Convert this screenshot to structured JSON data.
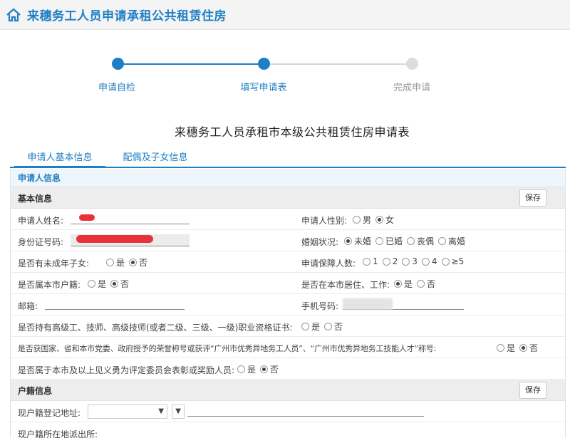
{
  "header": {
    "title": "来穗务工人员申请承租公共租赁住房"
  },
  "steps": [
    {
      "label": "申请自检"
    },
    {
      "label": "填写申请表"
    },
    {
      "label": "完成申请"
    }
  ],
  "form_title": "来穗务工人员承租市本级公共租赁住房申请表",
  "tabs": [
    {
      "label": "申请人基本信息"
    },
    {
      "label": "配偶及子女信息"
    }
  ],
  "panel_header": "申请人信息",
  "basic": {
    "title": "基本信息",
    "save_label": "保存",
    "name_label": "申请人姓名:",
    "gender_label": "申请人性别:",
    "gender_options": [
      "男",
      "女"
    ],
    "gender_selected": "女",
    "id_label": "身份证号码:",
    "marital_label": "婚姻状况:",
    "marital_options": [
      "未婚",
      "已婚",
      "丧偶",
      "离婚"
    ],
    "marital_selected": "未婚",
    "minor_label": "是否有未成年子女:",
    "yes": "是",
    "no": "否",
    "household_count_label": "申请保障人数:",
    "household_count_options": [
      "1",
      "2",
      "3",
      "4",
      "≥5"
    ],
    "local_hukou_label": "是否属本市户籍:",
    "live_work_label": "是否在本市居住、工作:",
    "email_label": "邮箱:",
    "phone_label": "手机号码:",
    "qualification_label": "是否持有高级工、技师、高级技师(或者二级、三级、一级)职业资格证书:",
    "honor_label": "是否获国家、省和本市党委、政府授予的荣誉称号或获评“广州市优秀异地务工人员”、“广州市优秀异地务工技能人才”称号:",
    "hero_label": "是否属于本市及以上见义勇为评定委员会表彰或奖励人员:"
  },
  "hukou": {
    "title": "户籍信息",
    "save_label": "保存",
    "address_label": "现户籍登记地址:",
    "police_label": "现户籍所在地派出所:"
  }
}
